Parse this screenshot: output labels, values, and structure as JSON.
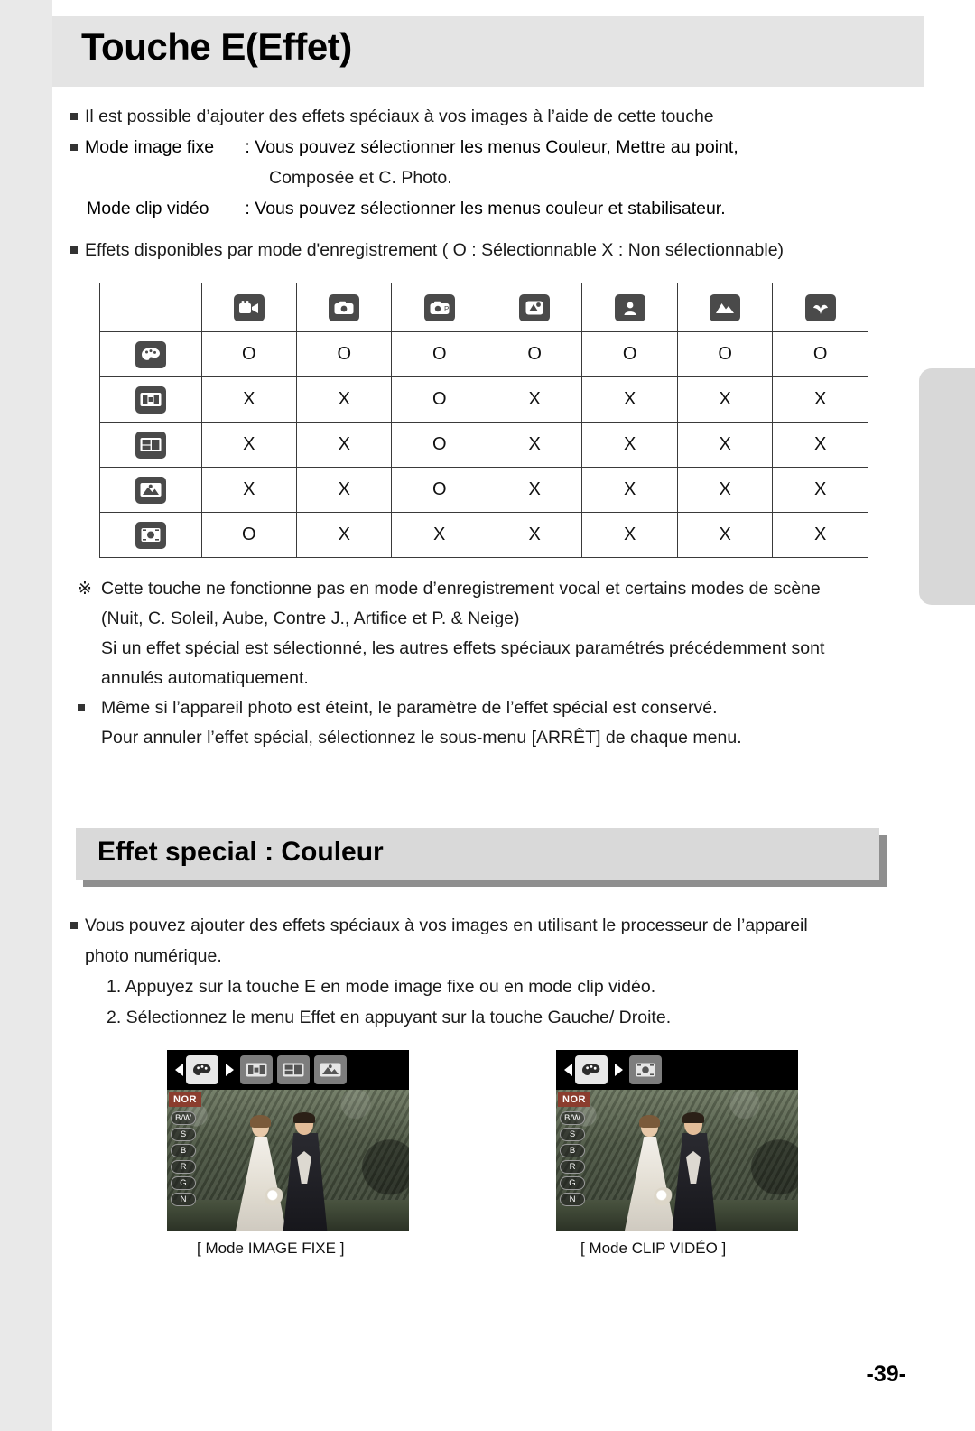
{
  "page": {
    "title": "Touche E(Effet)",
    "number": "-39-"
  },
  "intro": {
    "b1": "Il est possible d’ajouter des effets spéciaux à vos images à l’aide de cette touche",
    "mode_still_label": "Mode image fixe",
    "mode_still_text": ": Vous pouvez sélectionner les menus Couleur, Mettre au point,",
    "mode_still_cont": "Composée et C. Photo.",
    "mode_movie_label": "Mode clip vidéo",
    "mode_movie_text": ": Vous pouvez sélectionner les menus couleur et stabilisateur.",
    "b2": "Effets disponibles par mode d'enregistrement ( O : Sélectionnable X : Non sélectionnable)"
  },
  "table": {
    "col_icons": [
      "movie-camera-icon",
      "still-camera-icon",
      "program-camera-icon",
      "night-scene-icon",
      "portrait-icon",
      "landscape-icon",
      "macro-flower-icon"
    ],
    "row_icons": [
      "color-palette-icon",
      "frame-composite-icon",
      "photo-frame-icon",
      "picture-frame-icon",
      "focus-target-icon"
    ],
    "rows": [
      [
        "O",
        "O",
        "O",
        "O",
        "O",
        "O",
        "O"
      ],
      [
        "X",
        "X",
        "O",
        "X",
        "X",
        "X",
        "X"
      ],
      [
        "X",
        "X",
        "O",
        "X",
        "X",
        "X",
        "X"
      ],
      [
        "X",
        "X",
        "O",
        "X",
        "X",
        "X",
        "X"
      ],
      [
        "O",
        "X",
        "X",
        "X",
        "X",
        "X",
        "X"
      ]
    ]
  },
  "notes": {
    "n1": "Cette touche ne fonctionne pas en mode d’enregistrement vocal et certains modes de scène",
    "n1b": "(Nuit, C. Soleil, Aube, Contre J., Artifice et P. & Neige)",
    "n2": "Si un effet spécial est sélectionné, les autres effets spéciaux paramétrés précédemment sont",
    "n2b": "annulés automatiquement.",
    "n3": "Même si l’appareil photo est éteint, le paramètre de l’effet spécial est conservé.",
    "n3b": "Pour annuler l’effet spécial, sélectionnez le sous-menu [ARRÊT] de chaque menu.",
    "mark": "※"
  },
  "section2": {
    "heading": "Effet special : Couleur",
    "b1": "Vous pouvez ajouter des effets spéciaux à vos images en utilisant le processeur de l’appareil",
    "b1b": "photo numérique.",
    "step1": "1. Appuyez sur la touche E en mode image fixe ou en mode clip vidéo.",
    "step2": "2. Sélectionnez le menu Effet en appuyant sur la touche Gauche/ Droite."
  },
  "shots": {
    "still": {
      "caption": "[ Mode IMAGE FIXE ]",
      "mode_badge": "NOR",
      "options": [
        "B/W",
        "S",
        "B",
        "R",
        "G",
        "N"
      ],
      "toolbar_icons": [
        "color-palette-icon",
        "frame-composite-icon",
        "photo-frame-icon",
        "picture-frame-icon"
      ]
    },
    "movie": {
      "caption": "[ Mode CLIP VIDÉO ]",
      "mode_badge": "NOR",
      "options": [
        "B/W",
        "S",
        "B",
        "R",
        "G",
        "N"
      ],
      "toolbar_icons": [
        "color-palette-icon",
        "stabilizer-icon"
      ]
    }
  }
}
